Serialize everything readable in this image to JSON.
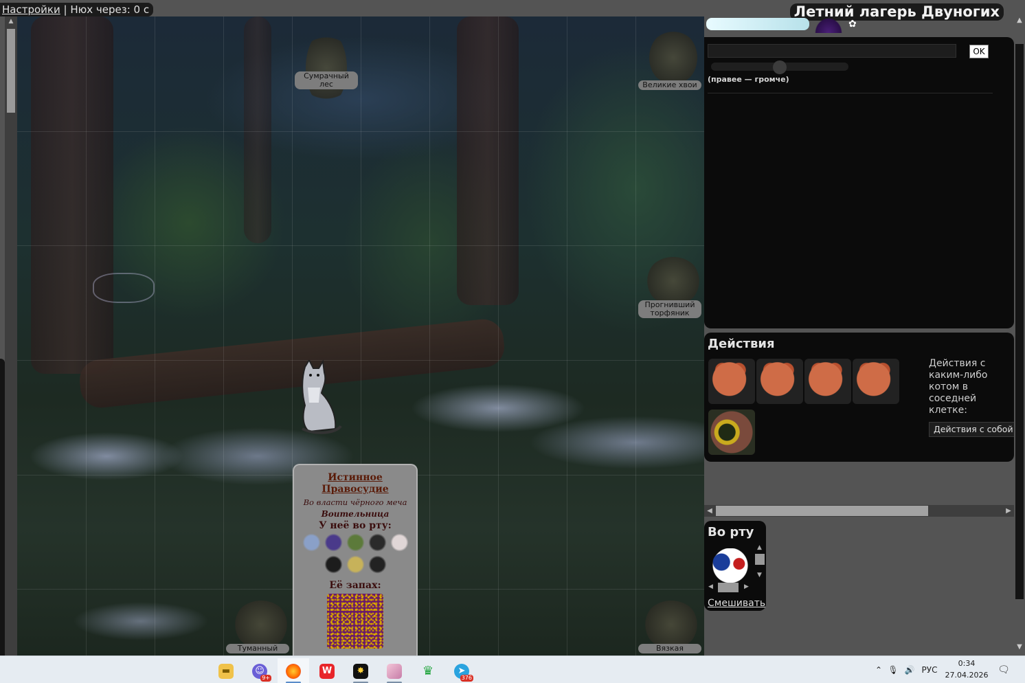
{
  "topbar": {
    "settings_link": "Настройки",
    "separator": "|",
    "sniff_text": "Нюх через: 0 с"
  },
  "location": {
    "title": "Летний лагерь Двуногих"
  },
  "field": {
    "transitions": [
      {
        "id": "sumrachny",
        "label": "Сумрачный лес"
      },
      {
        "id": "velikie",
        "label": "Великие хвои"
      },
      {
        "id": "prognivshiy",
        "label": "Прогнивший торфяник"
      },
      {
        "id": "tumanny",
        "label": "Туманный"
      },
      {
        "id": "vyazkaya",
        "label": "Вязкая"
      }
    ]
  },
  "cat_card": {
    "name": "Истинное Правосудие",
    "status": "Во власти чёрного меча",
    "rank": "Воительница",
    "mouth_heading": "У неё во рту:",
    "mouth_items": [
      {
        "icon": "cat-mask-icon",
        "color": "#8aa0c8"
      },
      {
        "icon": "blue-pouch-icon",
        "color": "#4a3a8a"
      },
      {
        "icon": "herb-bundle-icon",
        "color": "#5c7a3a"
      },
      {
        "icon": "black-cat-icon",
        "color": "#2a2a2a"
      },
      {
        "icon": "white-cat-icon",
        "color": "#e0d6d6"
      },
      {
        "icon": "crow-icon",
        "color": "#1c1c1c"
      },
      {
        "icon": "yellow-bird-icon",
        "color": "#c7b25a"
      },
      {
        "icon": "magpie-icon",
        "color": "#222222"
      }
    ],
    "smell_heading": "Её запах:"
  },
  "chat": {
    "ok_label": "OK",
    "volume_hint": "(правее — громче)",
    "volume_level": 0.5
  },
  "actions": {
    "title": "Действия",
    "icons": [
      "sleeping-cat-icon",
      "hissing-cat-icon",
      "digging-cat-icon",
      "crouching-cat-icon",
      "swamp-eye-icon"
    ],
    "description": "Действия с каким-либо котом в соседней клетке:",
    "self_button": "Действия с собой"
  },
  "mouth_panel": {
    "title": "Во рту",
    "item_icon": "kitsune-mask-icon",
    "mix_link": "Смешивать"
  },
  "taskbar": {
    "apps": [
      {
        "name": "file-explorer-icon",
        "badge": ""
      },
      {
        "name": "discord-icon",
        "badge": "9+"
      },
      {
        "name": "firefox-icon",
        "badge": ""
      },
      {
        "name": "wps-office-icon",
        "badge": ""
      },
      {
        "name": "sparkle-app-icon",
        "badge": ""
      },
      {
        "name": "anime-app-icon",
        "badge": ""
      },
      {
        "name": "crown-app-icon",
        "badge": ""
      },
      {
        "name": "telegram-icon",
        "badge": "376"
      }
    ],
    "language": "РУС",
    "time": "0:34",
    "date": "27.04.2026"
  }
}
